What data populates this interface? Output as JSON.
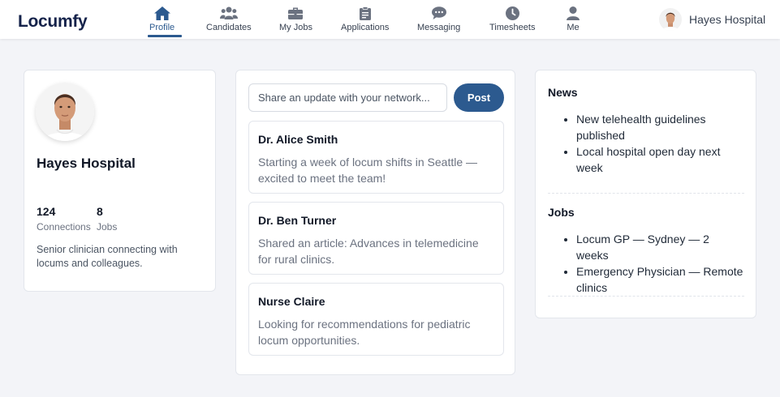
{
  "app": {
    "logo": "Locumfy"
  },
  "nav": {
    "items": [
      {
        "label": "Profile",
        "icon": "home-icon",
        "active": true
      },
      {
        "label": "Candidates",
        "icon": "users-icon"
      },
      {
        "label": "My Jobs",
        "icon": "briefcase-icon"
      },
      {
        "label": "Applications",
        "icon": "clipboard-icon"
      },
      {
        "label": "Messaging",
        "icon": "chat-bubble-icon"
      },
      {
        "label": "Timesheets",
        "icon": "clock-icon"
      },
      {
        "label": "Me",
        "icon": "user-icon"
      }
    ]
  },
  "user": {
    "name": "Hayes Hospital"
  },
  "profile": {
    "name": "Hayes Hospital",
    "connections": {
      "value": "124",
      "label": "Connections"
    },
    "jobs": {
      "value": "8",
      "label": "Jobs"
    },
    "bio": "Senior clinician connecting with locums and colleagues."
  },
  "feed": {
    "placeholder": "Share an update with your network...",
    "post_label": "Post",
    "posts": [
      {
        "author": "Dr. Alice Smith",
        "body": "Starting a week of locum shifts in Seattle — excited to meet the team!"
      },
      {
        "author": "Dr. Ben Turner",
        "body": "Shared an article: Advances in telemedicine for rural clinics."
      },
      {
        "author": "Nurse Claire",
        "body": "Looking for recommendations for pediatric locum opportunities."
      }
    ]
  },
  "sidebar": {
    "news": {
      "title": "News",
      "items": [
        "New telehealth guidelines published",
        "Local hospital open day next week"
      ]
    },
    "jobs": {
      "title": "Jobs",
      "items": [
        "Locum GP — Sydney — 2 weeks",
        "Emergency Physician — Remote clinics"
      ]
    }
  },
  "colors": {
    "accent": "#2c5a8f",
    "logo": "#14224a",
    "background": "#f3f4f8"
  }
}
